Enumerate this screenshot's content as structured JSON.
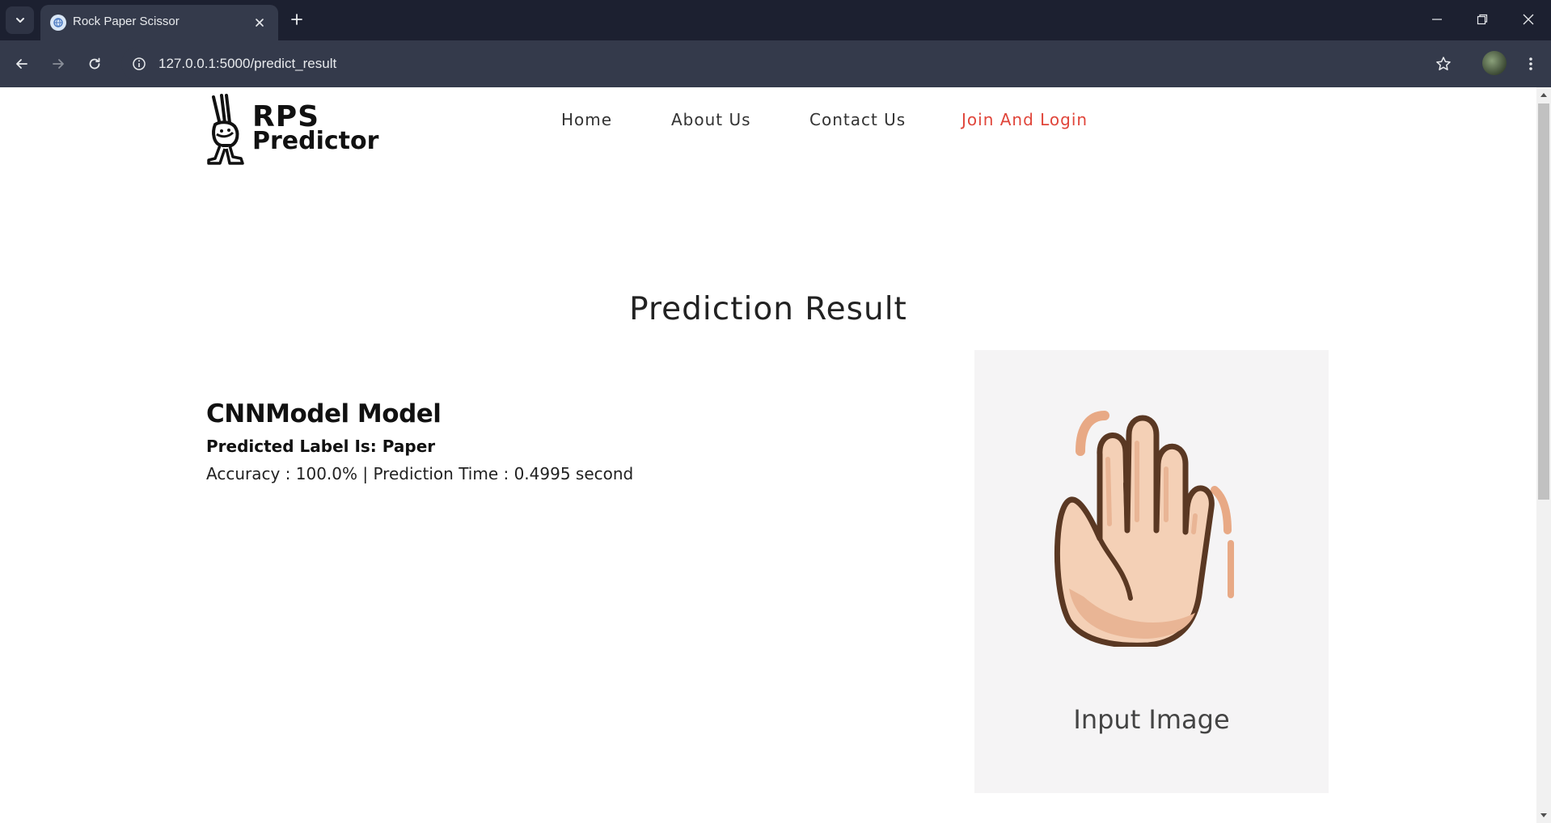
{
  "browser": {
    "tab_title": "Rock Paper Scissor",
    "url": "127.0.0.1:5000/predict_result",
    "icons": [
      "chevron-down-icon",
      "globe-icon",
      "close-icon",
      "plus-icon",
      "minimize-icon",
      "restore-icon",
      "close-window-icon",
      "back-arrow-icon",
      "forward-arrow-icon",
      "reload-icon",
      "info-icon",
      "star-icon",
      "more-vert-icon"
    ]
  },
  "site": {
    "logo_line1": "RPS",
    "logo_line2": "Predictor",
    "nav": {
      "home": "Home",
      "about": "About Us",
      "contact": "Contact Us",
      "join": "Join And Login"
    },
    "accent_color": "#e0453a"
  },
  "result": {
    "heading": "Prediction Result",
    "model_title": "CNNModel Model",
    "predicted_label": "Predicted Label Is: Paper",
    "stats": "Accuracy : 100.0% | Prediction Time : 0.4995 second",
    "image_caption": "Input Image"
  }
}
